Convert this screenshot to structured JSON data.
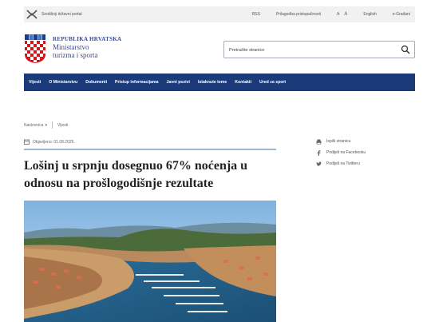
{
  "topbar": {
    "portal_label": "Središnji državni portal",
    "links": [
      "RSS",
      "Prilagodba pristupačnosti",
      "A",
      "A",
      "English",
      "e-Građani"
    ]
  },
  "header": {
    "ministry_line1": "REPUBLIKA HRVATSKA",
    "ministry_line2": "Ministarstvo",
    "ministry_line3": "turizma i sporta",
    "search_placeholder": "Pretražite stranice"
  },
  "nav": {
    "items": [
      "Vijesti",
      "O Ministarstvu",
      "Dokumenti",
      "Pristup informacijama",
      "Javni pozivi",
      "Istaknute teme",
      "Kontakti",
      "Ured za sport"
    ]
  },
  "breadcrumb": {
    "home": "Naslovnica",
    "current": "Vijesti"
  },
  "article": {
    "published": "Objavljeno: 01.08.2025.",
    "title": "Lošinj u srpnju dosegnuo 67% noćenja u odnosu na prošlogodišnje rezultate"
  },
  "share": {
    "items": [
      "Ispiši stranicu",
      "Podijeli na Facebooku",
      "Podijeli na Twitteru"
    ]
  },
  "colors": {
    "nav_bg": "#1b3a7a",
    "ministry_text": "#3a4a8c",
    "topbar_bg": "#f1f1f1"
  }
}
